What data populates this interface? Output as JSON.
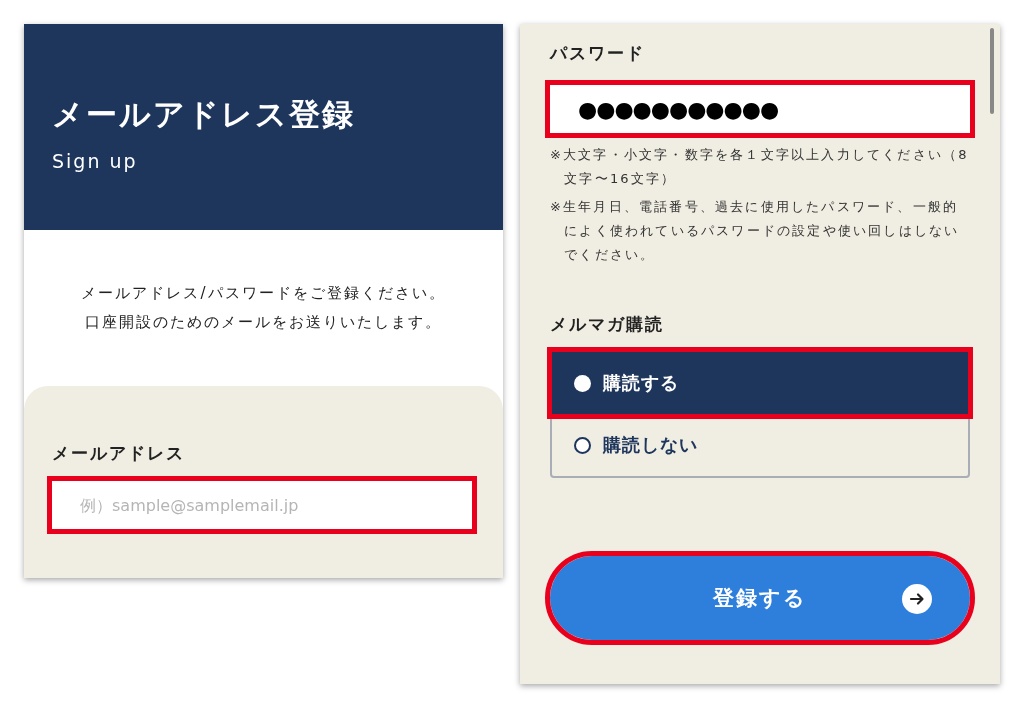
{
  "signup_screen": {
    "header": {
      "title": "メールアドレス登録",
      "subtitle": "Sign up"
    },
    "intro": [
      "メールアドレス/パスワードをご登録ください。",
      "口座開設のためのメールをお送りいたします。"
    ],
    "email": {
      "label": "メールアドレス",
      "placeholder": "例）sample@samplemail.jp",
      "highlighted": true
    }
  },
  "form_screen": {
    "password": {
      "label": "パスワード",
      "value": "●●●●●●●●●●●",
      "highlighted": true,
      "notes": [
        "※大文字・小文字・数字を各１文字以上入力してください（8文字〜16文字）",
        "※生年月日、電話番号、過去に使用したパスワード、一般的によく使われているパスワードの設定や使い回しはしないでください。"
      ]
    },
    "newsletter": {
      "label": "メルマガ購読",
      "options": [
        {
          "label": "購読する",
          "selected": true,
          "highlighted": true
        },
        {
          "label": "購読しない",
          "selected": false,
          "highlighted": false
        }
      ]
    },
    "submit": {
      "label": "登録する",
      "highlighted": true
    }
  }
}
